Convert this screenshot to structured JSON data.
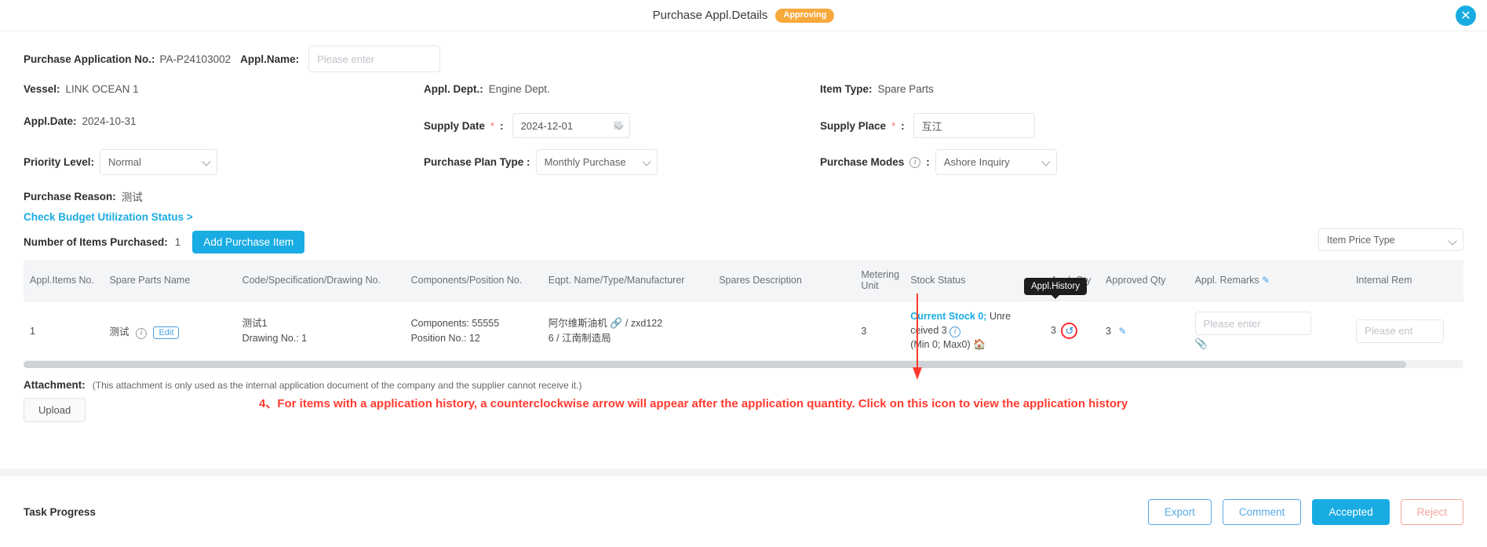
{
  "window": {
    "title": "Purchase Appl.Details",
    "status_badge": "Approving",
    "close_icon": "close-icon"
  },
  "form": {
    "purchase_application_no_label": "Purchase Application No.:",
    "purchase_application_no_value": "PA-P24103002",
    "appl_name_label": "Appl.Name:",
    "appl_name_placeholder": "Please enter",
    "appl_name_value": "",
    "vessel_label": "Vessel:",
    "vessel_value": "LINK OCEAN 1",
    "appl_date_label": "Appl.Date:",
    "appl_date_value": "2024-10-31",
    "appl_dept_label": "Appl. Dept.:",
    "appl_dept_value": "Engine Dept.",
    "supply_date_label": "Supply Date",
    "supply_date_value": "2024-12-01",
    "purchase_plan_type_label": "Purchase Plan Type :",
    "purchase_plan_type_value": "Monthly Purchase",
    "item_type_label": "Item Type:",
    "item_type_value": "Spare Parts",
    "supply_place_label": "Supply Place",
    "supply_place_value": "互江",
    "purchase_modes_label": "Purchase Modes",
    "purchase_modes_value": "Ashore Inquiry",
    "priority_level_label": "Priority Level:",
    "priority_level_value": "Normal",
    "purchase_reason_label": "Purchase Reason:",
    "purchase_reason_value": "测试",
    "check_budget_link": "Check Budget Utilization Status >",
    "number_of_items_label": "Number of Items Purchased:",
    "number_of_items_value": "1",
    "add_purchase_item_button": "Add Purchase Item",
    "item_price_type_select": "Item Price Type",
    "colon": ":"
  },
  "table": {
    "headers": [
      "Appl.Items No.",
      "Spare Parts Name",
      "Code/Specification/Drawing No.",
      "Components/Position No.",
      "Eqpt. Name/Type/Manufacturer",
      "Spares Description",
      "Metering Unit",
      "Stock Status",
      "Appl. Qty",
      "Approved Qty",
      "Appl. Remarks",
      "Internal Rem"
    ],
    "rows": [
      {
        "appl_items_no": "1",
        "spare_parts_name": "测试",
        "edit_label": "Edit",
        "code_line1": "测试1",
        "code_line2": "Drawing No.:  1",
        "components_line1": "Components:  55555",
        "components_line2": "Position No.:  12",
        "eqpt_line1": "阿尔维斯油机",
        "eqpt_line1b": "/ zxd122",
        "eqpt_line2": "6 / 江南制造局",
        "spares_description": "",
        "metering_unit": "3",
        "stock_strong": "Current Stock 0;",
        "stock_rest": "Unre",
        "stock_line2": "ceived 3",
        "stock_line3": "(Min 0; Max0)",
        "appl_qty": "3",
        "approved_qty": "3",
        "appl_remarks_placeholder": "Please enter",
        "internal_remarks_placeholder": "Please ent"
      }
    ],
    "tooltip": "Appl.History"
  },
  "attachment": {
    "label": "Attachment:",
    "note": "(This attachment is only used as the internal application document of the company and the supplier cannot receive it.)",
    "upload_button": "Upload"
  },
  "annotation": {
    "text": "4、For items with a application history, a counterclockwise arrow will appear after the application quantity. Click on this icon to view the application history",
    "color": "#ff3b30"
  },
  "footer": {
    "task_progress": "Task Progress",
    "buttons": [
      {
        "label": "Export",
        "style": "outline-blue"
      },
      {
        "label": "Comment",
        "style": "outline-blue"
      },
      {
        "label": "Accepted",
        "style": "solid-blue"
      },
      {
        "label": "Reject",
        "style": "outline-red"
      }
    ]
  },
  "colors": {
    "accent": "#19ace3",
    "badge": "#f7a93b",
    "annotation_red": "#ff3b30",
    "header_bg": "#f4f5f7"
  }
}
